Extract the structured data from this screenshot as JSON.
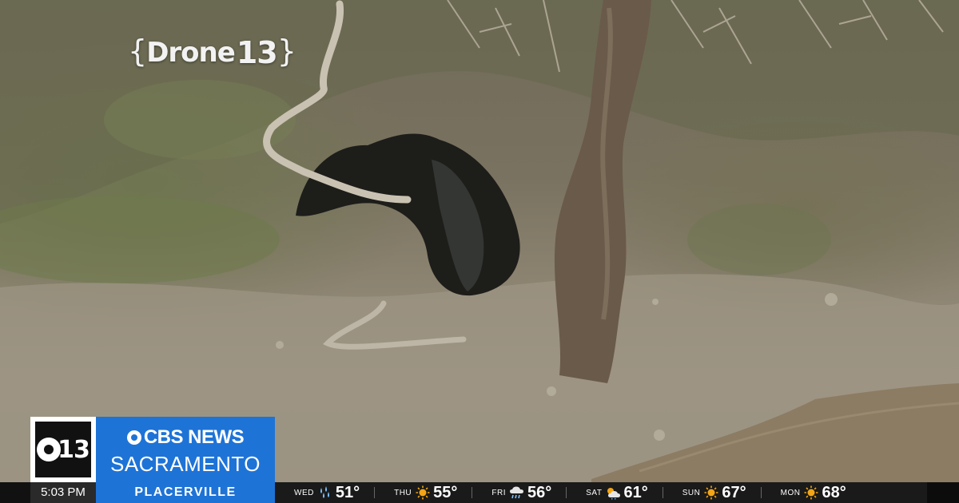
{
  "station_bug": {
    "prefix": "{",
    "word": "Drone",
    "number": "13",
    "suffix": "}"
  },
  "lower_third": {
    "logo_number": "13",
    "brand_line1": "CBS NEWS",
    "brand_line2": "SACRAMENTO"
  },
  "ticker": {
    "time": "5:03 PM",
    "location": "PLACERVILLE",
    "forecast": [
      {
        "day": "WED",
        "icon": "rain-icon",
        "temp": "51°"
      },
      {
        "day": "THU",
        "icon": "sun-icon",
        "temp": "55°"
      },
      {
        "day": "FRI",
        "icon": "rain-cloud-icon",
        "temp": "56°"
      },
      {
        "day": "SAT",
        "icon": "partly-cloudy-icon",
        "temp": "61°"
      },
      {
        "day": "SUN",
        "icon": "sun-icon",
        "temp": "67°"
      },
      {
        "day": "MON",
        "icon": "sun-icon",
        "temp": "68°"
      }
    ]
  },
  "colors": {
    "brand_blue": "#1e73d6",
    "ticker_black": "#111111",
    "sun": "#f2a516",
    "rain": "#7fc3ff"
  }
}
